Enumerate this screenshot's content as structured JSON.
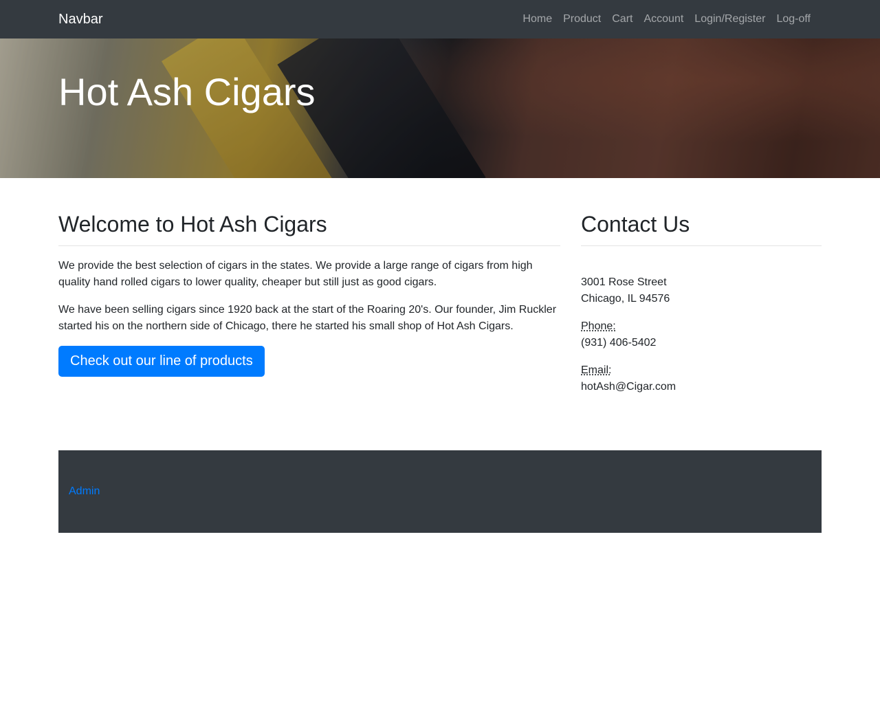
{
  "navbar": {
    "brand": "Navbar",
    "links": [
      "Home",
      "Product",
      "Cart",
      "Account",
      "Login/Register",
      "Log-off"
    ]
  },
  "hero": {
    "title": "Hot Ash Cigars"
  },
  "main": {
    "heading": "Welcome to Hot Ash Cigars",
    "paragraph1": "We provide the best selection of cigars in the states. We provide a large range of cigars from high quality hand rolled cigars to lower quality, cheaper but still just as good cigars.",
    "paragraph2": "We have been selling cigars since 1920 back at the start of the Roaring 20's. Our founder, Jim Ruckler started his on the northern side of Chicago, there he started his small shop of Hot Ash Cigars.",
    "button_label": "Check out our line of products"
  },
  "contact": {
    "heading": "Contact Us",
    "address_line1": "3001 Rose Street",
    "address_line2": "Chicago, IL 94576",
    "phone_label": "Phone:",
    "phone": "(931) 406-5402",
    "email_label": "Email:",
    "email": "hotAsh@Cigar.com"
  },
  "footer": {
    "admin_link": "Admin"
  },
  "colors": {
    "navbar_bg": "#343a40",
    "primary": "#007bff",
    "text": "#212529"
  }
}
